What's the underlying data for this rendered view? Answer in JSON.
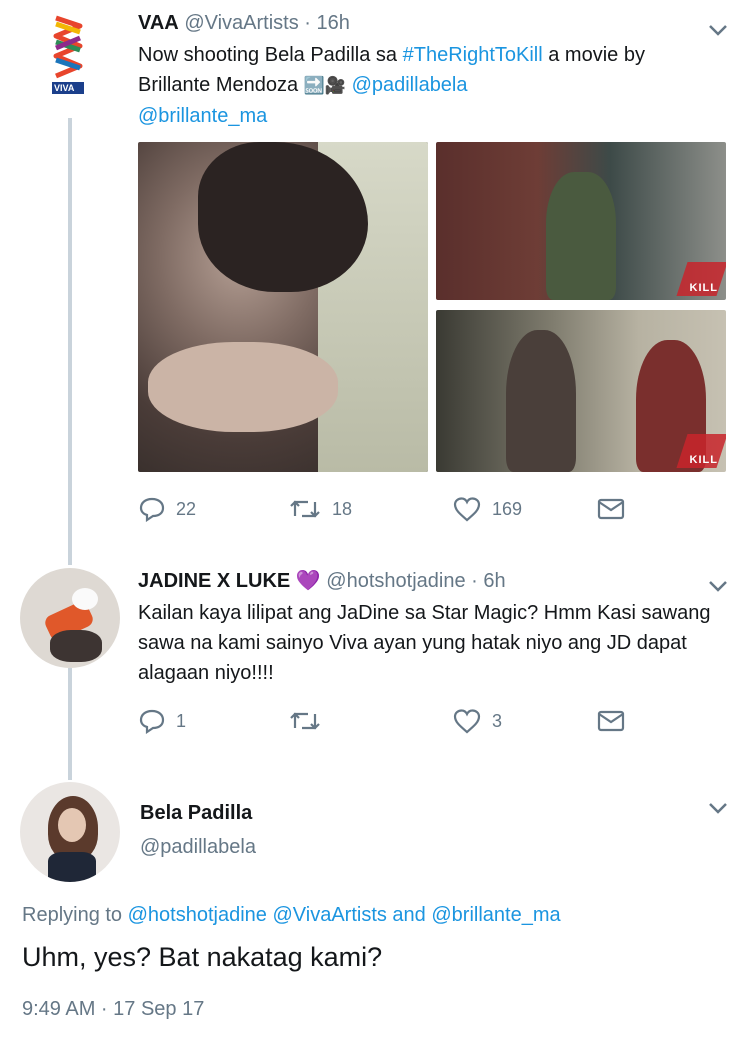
{
  "tweet1": {
    "display_name": "VAA",
    "handle": "@VivaArtists",
    "time": "· 16h",
    "text_line1": "Now shooting Bela Padilla  sa ",
    "hashtag": "#TheRightToKill",
    "text_line1_end": " a movie by",
    "text_line2": "Brillante Mendoza ",
    "emoji": "🔜🎥",
    "mention1": "@padillabela",
    "mention2": "@brillante_ma",
    "replies": "22",
    "retweets": "18",
    "likes": "169",
    "avatar_label": "VIVA",
    "media_badge": "KILL"
  },
  "tweet2": {
    "display_name": "JADINE X LUKE",
    "heart": "💜",
    "handle": "@hotshotjadine",
    "time": "· 6h",
    "text": "Kailan kaya lilipat ang JaDine sa Star Magic? Hmm Kasi sawang sawa na kami sainyo Viva ayan yung hatak niyo ang JD dapat alagaan niyo!!!!",
    "replies": "1",
    "likes": "3"
  },
  "tweet3": {
    "display_name": "Bela Padilla",
    "handle": "@padillabela",
    "replying_prefix": "Replying to ",
    "replying_to": "@hotshotjadine @VivaArtists and @brillante_ma",
    "text": "Uhm, yes? Bat nakatag kami?",
    "timestamp": "9:49 AM · 17 Sep 17"
  },
  "icons": [
    "chevron-down-icon",
    "reply-icon",
    "retweet-icon",
    "like-icon",
    "dm-icon"
  ],
  "colors": {
    "link": "#1b95e0",
    "muted": "#657786",
    "thread": "#c9d3db",
    "heart": "#8e44ad"
  }
}
